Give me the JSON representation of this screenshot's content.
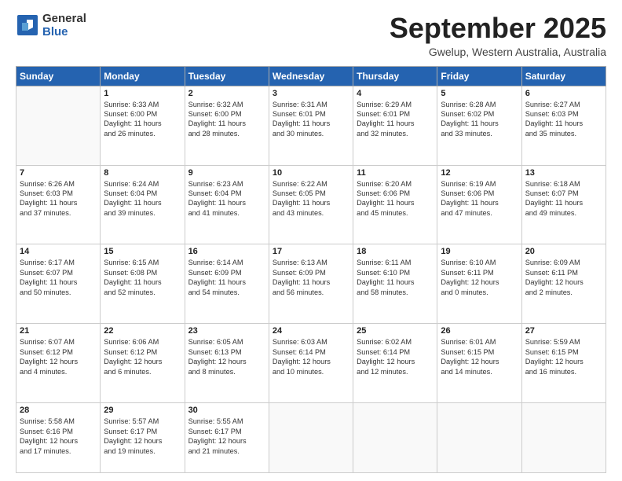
{
  "logo": {
    "general": "General",
    "blue": "Blue"
  },
  "header": {
    "month": "September 2025",
    "location": "Gwelup, Western Australia, Australia"
  },
  "weekdays": [
    "Sunday",
    "Monday",
    "Tuesday",
    "Wednesday",
    "Thursday",
    "Friday",
    "Saturday"
  ],
  "weeks": [
    [
      {
        "day": "",
        "info": ""
      },
      {
        "day": "1",
        "info": "Sunrise: 6:33 AM\nSunset: 6:00 PM\nDaylight: 11 hours\nand 26 minutes."
      },
      {
        "day": "2",
        "info": "Sunrise: 6:32 AM\nSunset: 6:00 PM\nDaylight: 11 hours\nand 28 minutes."
      },
      {
        "day": "3",
        "info": "Sunrise: 6:31 AM\nSunset: 6:01 PM\nDaylight: 11 hours\nand 30 minutes."
      },
      {
        "day": "4",
        "info": "Sunrise: 6:29 AM\nSunset: 6:01 PM\nDaylight: 11 hours\nand 32 minutes."
      },
      {
        "day": "5",
        "info": "Sunrise: 6:28 AM\nSunset: 6:02 PM\nDaylight: 11 hours\nand 33 minutes."
      },
      {
        "day": "6",
        "info": "Sunrise: 6:27 AM\nSunset: 6:03 PM\nDaylight: 11 hours\nand 35 minutes."
      }
    ],
    [
      {
        "day": "7",
        "info": "Sunrise: 6:26 AM\nSunset: 6:03 PM\nDaylight: 11 hours\nand 37 minutes."
      },
      {
        "day": "8",
        "info": "Sunrise: 6:24 AM\nSunset: 6:04 PM\nDaylight: 11 hours\nand 39 minutes."
      },
      {
        "day": "9",
        "info": "Sunrise: 6:23 AM\nSunset: 6:04 PM\nDaylight: 11 hours\nand 41 minutes."
      },
      {
        "day": "10",
        "info": "Sunrise: 6:22 AM\nSunset: 6:05 PM\nDaylight: 11 hours\nand 43 minutes."
      },
      {
        "day": "11",
        "info": "Sunrise: 6:20 AM\nSunset: 6:06 PM\nDaylight: 11 hours\nand 45 minutes."
      },
      {
        "day": "12",
        "info": "Sunrise: 6:19 AM\nSunset: 6:06 PM\nDaylight: 11 hours\nand 47 minutes."
      },
      {
        "day": "13",
        "info": "Sunrise: 6:18 AM\nSunset: 6:07 PM\nDaylight: 11 hours\nand 49 minutes."
      }
    ],
    [
      {
        "day": "14",
        "info": "Sunrise: 6:17 AM\nSunset: 6:07 PM\nDaylight: 11 hours\nand 50 minutes."
      },
      {
        "day": "15",
        "info": "Sunrise: 6:15 AM\nSunset: 6:08 PM\nDaylight: 11 hours\nand 52 minutes."
      },
      {
        "day": "16",
        "info": "Sunrise: 6:14 AM\nSunset: 6:09 PM\nDaylight: 11 hours\nand 54 minutes."
      },
      {
        "day": "17",
        "info": "Sunrise: 6:13 AM\nSunset: 6:09 PM\nDaylight: 11 hours\nand 56 minutes."
      },
      {
        "day": "18",
        "info": "Sunrise: 6:11 AM\nSunset: 6:10 PM\nDaylight: 11 hours\nand 58 minutes."
      },
      {
        "day": "19",
        "info": "Sunrise: 6:10 AM\nSunset: 6:11 PM\nDaylight: 12 hours\nand 0 minutes."
      },
      {
        "day": "20",
        "info": "Sunrise: 6:09 AM\nSunset: 6:11 PM\nDaylight: 12 hours\nand 2 minutes."
      }
    ],
    [
      {
        "day": "21",
        "info": "Sunrise: 6:07 AM\nSunset: 6:12 PM\nDaylight: 12 hours\nand 4 minutes."
      },
      {
        "day": "22",
        "info": "Sunrise: 6:06 AM\nSunset: 6:12 PM\nDaylight: 12 hours\nand 6 minutes."
      },
      {
        "day": "23",
        "info": "Sunrise: 6:05 AM\nSunset: 6:13 PM\nDaylight: 12 hours\nand 8 minutes."
      },
      {
        "day": "24",
        "info": "Sunrise: 6:03 AM\nSunset: 6:14 PM\nDaylight: 12 hours\nand 10 minutes."
      },
      {
        "day": "25",
        "info": "Sunrise: 6:02 AM\nSunset: 6:14 PM\nDaylight: 12 hours\nand 12 minutes."
      },
      {
        "day": "26",
        "info": "Sunrise: 6:01 AM\nSunset: 6:15 PM\nDaylight: 12 hours\nand 14 minutes."
      },
      {
        "day": "27",
        "info": "Sunrise: 5:59 AM\nSunset: 6:15 PM\nDaylight: 12 hours\nand 16 minutes."
      }
    ],
    [
      {
        "day": "28",
        "info": "Sunrise: 5:58 AM\nSunset: 6:16 PM\nDaylight: 12 hours\nand 17 minutes."
      },
      {
        "day": "29",
        "info": "Sunrise: 5:57 AM\nSunset: 6:17 PM\nDaylight: 12 hours\nand 19 minutes."
      },
      {
        "day": "30",
        "info": "Sunrise: 5:55 AM\nSunset: 6:17 PM\nDaylight: 12 hours\nand 21 minutes."
      },
      {
        "day": "",
        "info": ""
      },
      {
        "day": "",
        "info": ""
      },
      {
        "day": "",
        "info": ""
      },
      {
        "day": "",
        "info": ""
      }
    ]
  ]
}
